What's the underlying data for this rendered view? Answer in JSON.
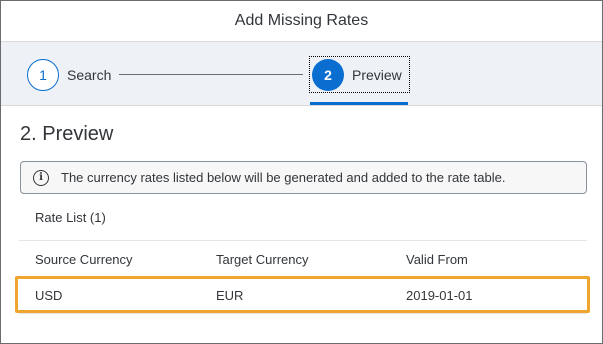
{
  "dialog": {
    "title": "Add Missing Rates"
  },
  "wizard": {
    "steps": [
      {
        "number": "1",
        "label": "Search",
        "state": "completed"
      },
      {
        "number": "2",
        "label": "Preview",
        "state": "current"
      }
    ]
  },
  "section": {
    "title": "2. Preview"
  },
  "info_strip": {
    "icon": "info-icon",
    "glyph": "i",
    "text": "The currency rates listed below will be generated and added to the rate table."
  },
  "rate_list": {
    "title": "Rate List (1)",
    "columns": [
      "Source Currency",
      "Target Currency",
      "Valid From"
    ],
    "rows": [
      [
        "USD",
        "EUR",
        "2019-01-01"
      ]
    ]
  },
  "colors": {
    "accent": "#0a6ed1",
    "highlight": "#f0a52e",
    "wizard_bg": "#eef2f6"
  }
}
